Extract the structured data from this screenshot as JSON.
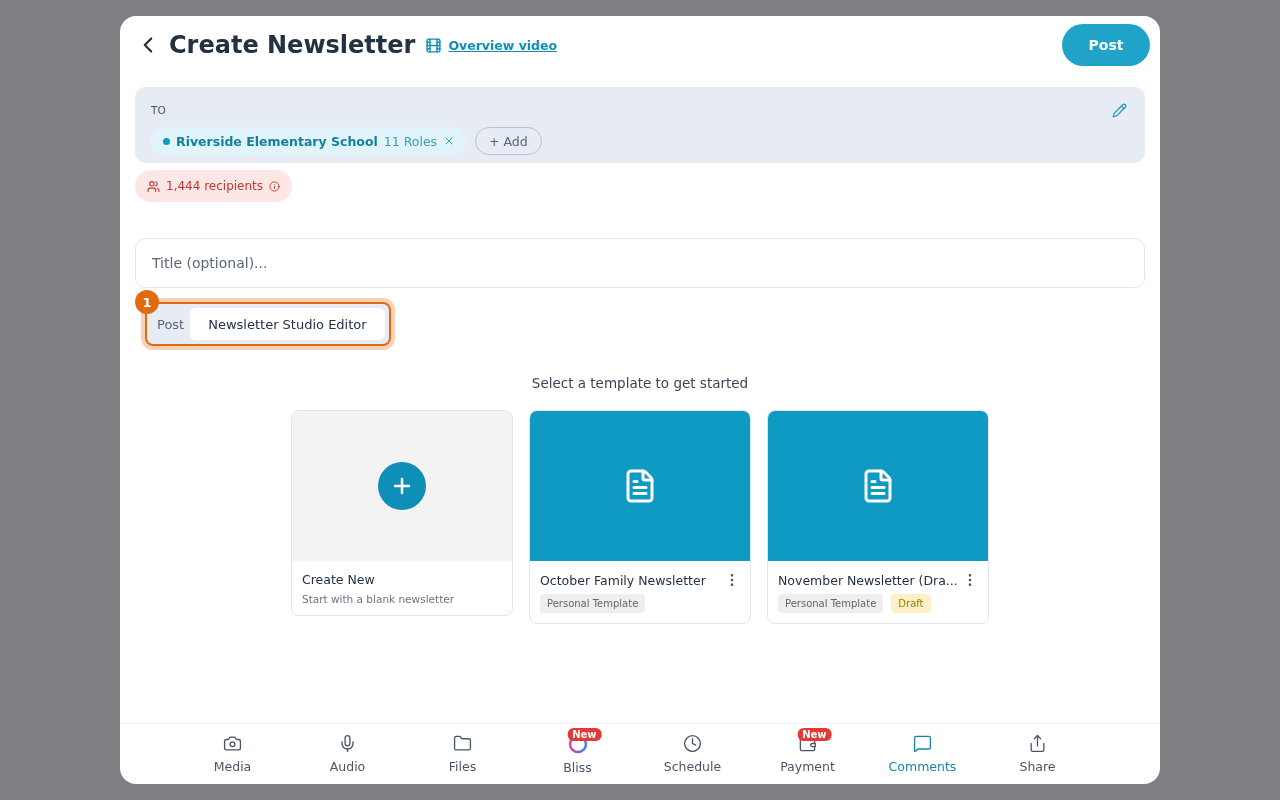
{
  "header": {
    "title": "Create Newsletter",
    "video_link": "Overview video",
    "post_button": "Post"
  },
  "recipients": {
    "label": "TO",
    "chips": [
      {
        "name": "Riverside Elementary School",
        "roles": "11 Roles",
        "color": "#0e9ac2"
      }
    ],
    "add_button": "+ Add",
    "count": "1,444 recipients"
  },
  "title_field": {
    "placeholder": "Title (optional)..."
  },
  "editor_tabs": {
    "step_badge": "1",
    "tabs": [
      {
        "label": "Post",
        "selected": false
      },
      {
        "label": "Newsletter Studio Editor",
        "selected": true
      }
    ]
  },
  "templates": {
    "heading": "Select a template to get started",
    "items": [
      {
        "kind": "create",
        "title": "Create New",
        "subtitle": "Start with a blank newsletter"
      },
      {
        "kind": "template",
        "title": "October Family Newsletter",
        "tags": [
          {
            "label": "Personal Template",
            "color": "#eeeeee"
          }
        ]
      },
      {
        "kind": "template",
        "title": "November Newsletter (Dra...",
        "tags": [
          {
            "label": "Personal Template",
            "color": "#eeeeee"
          },
          {
            "label": "Draft",
            "color": "#fdf0c4"
          }
        ]
      }
    ]
  },
  "toolbar": [
    {
      "label": "Media",
      "selected": false
    },
    {
      "label": "Audio",
      "selected": false
    },
    {
      "label": "Files",
      "selected": false
    },
    {
      "label": "Bliss",
      "selected": false,
      "badge": "New"
    },
    {
      "label": "Schedule",
      "selected": false
    },
    {
      "label": "Payment",
      "selected": false,
      "badge": "New"
    },
    {
      "label": "Comments",
      "selected": true
    },
    {
      "label": "Share",
      "selected": false
    }
  ]
}
